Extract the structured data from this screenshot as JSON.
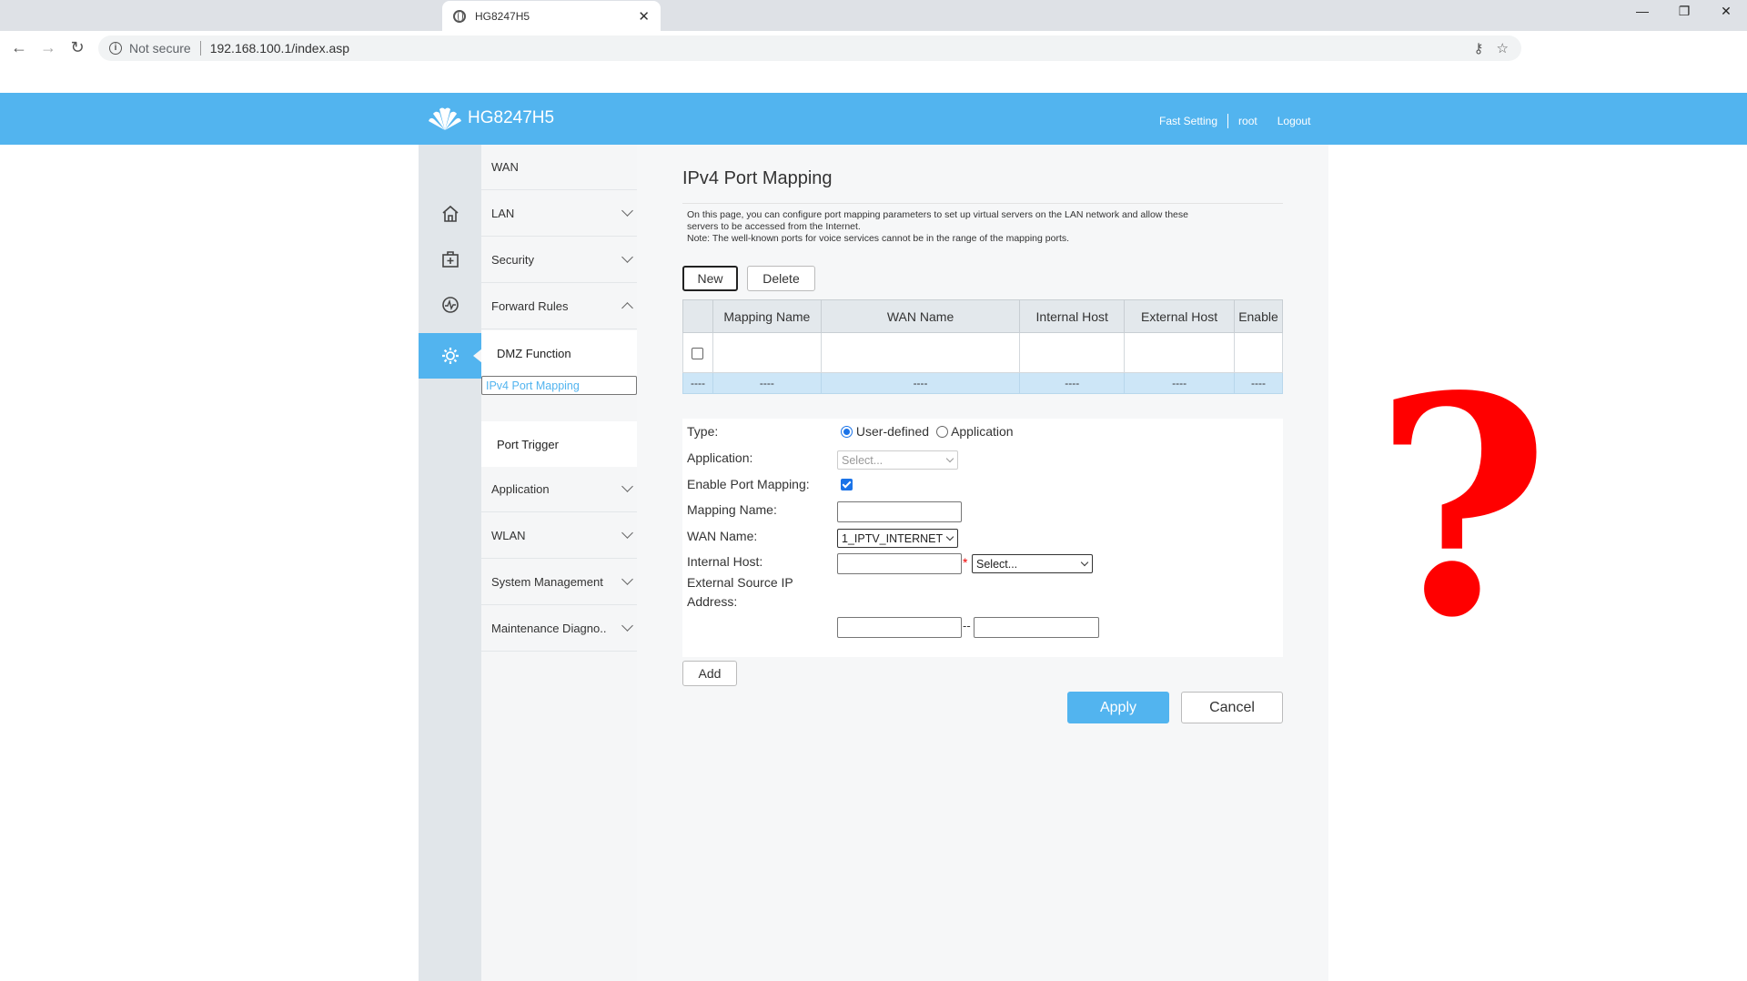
{
  "browser": {
    "tab_title": "HG8247H5",
    "not_secure": "Not secure",
    "url": "192.168.100.1/index.asp"
  },
  "header": {
    "logo_text": "HG8247H5",
    "fast_setting": "Fast Setting",
    "user": "root",
    "logout": "Logout"
  },
  "menu": {
    "items": [
      {
        "label": "WAN"
      },
      {
        "label": "LAN"
      },
      {
        "label": "Security"
      },
      {
        "label": "Forward Rules"
      },
      {
        "label": "Application"
      },
      {
        "label": "WLAN"
      },
      {
        "label": "System Management"
      },
      {
        "label": "Maintenance Diagno.."
      }
    ],
    "sub_items": [
      {
        "label": "DMZ Function"
      },
      {
        "label": "IPv4 Port Mapping"
      },
      {
        "label": "Port Trigger"
      }
    ]
  },
  "page": {
    "title": "IPv4 Port Mapping",
    "desc_line1": "On this page, you can configure port mapping parameters to set up virtual servers on the LAN network and allow these",
    "desc_line2": "servers to be accessed from the Internet.",
    "desc_line3": "Note: The well-known ports for voice services cannot be in the range of the mapping ports.",
    "new_label": "New",
    "delete_label": "Delete"
  },
  "table": {
    "columns": [
      "Mapping Name",
      "WAN Name",
      "Internal Host",
      "External Host",
      "Enable"
    ],
    "dash_row": [
      "----",
      "----",
      "----",
      "----",
      "----",
      "----"
    ]
  },
  "form": {
    "type_label": "Type:",
    "type_opt1": "User-defined",
    "type_opt2": "Application",
    "application_label": "Application:",
    "application_value": "Select...",
    "enable_label": "Enable Port Mapping:",
    "mapping_name_label": "Mapping Name:",
    "wan_name_label": "WAN Name:",
    "wan_name_value": "1_IPTV_INTERNET",
    "internal_host_label": "Internal Host:",
    "internal_host_select": "Select...",
    "required_mark": "*",
    "ext_ip_label1": "External Source IP",
    "ext_ip_label2": "Address:",
    "range_sep": "--",
    "add_label": "Add",
    "apply_label": "Apply",
    "cancel_label": "Cancel"
  },
  "overlay": {
    "symbol": "?",
    "color": "#ff0000"
  },
  "colors": {
    "brand": "#52b4ef",
    "selected_menu": "#52b4ef"
  }
}
